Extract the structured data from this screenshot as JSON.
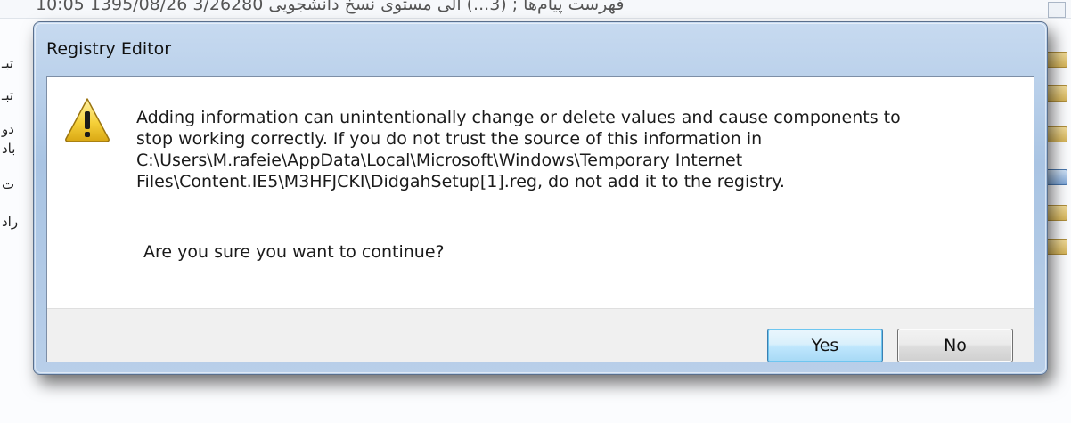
{
  "background": {
    "top_row_text": "فهرست پیام‌ها ; (3...) الی      مستوی نسخ دانشجویی      3/26280    1395/08/26 10:05",
    "left_fragments": [
      "تبـ",
      "تبـ",
      "دو",
      "باد",
      "ت",
      "راد"
    ]
  },
  "dialog": {
    "title": "Registry Editor",
    "icon": "warning-icon",
    "message": "Adding information can unintentionally change or delete values and cause components to\nstop working correctly. If you do not trust the source of this information in\nC:\\Users\\M.rafeie\\AppData\\Local\\Microsoft\\Windows\\Temporary Internet\nFiles\\Content.IE5\\M3HFJCKI\\DidgahSetup[1].reg, do not add it to the registry.",
    "question": "Are you sure you want to continue?",
    "buttons": {
      "yes": "Yes",
      "no": "No"
    }
  },
  "colors": {
    "frame": "#b9cfe9",
    "default_button": "#bee6fd",
    "warning": "#f6d13a"
  }
}
